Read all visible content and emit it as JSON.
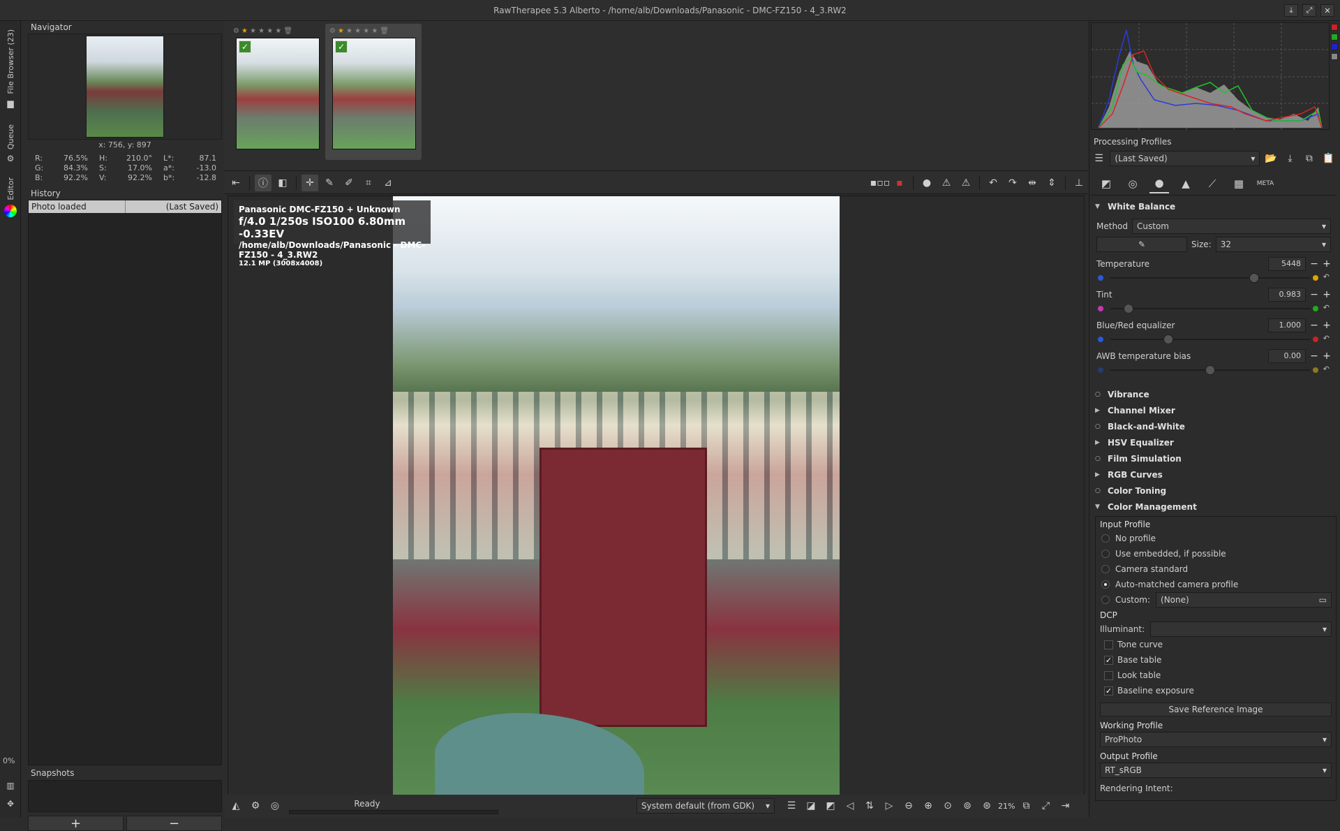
{
  "window": {
    "title": "RawTherapee 5.3 Alberto - /home/alb/Downloads/Panasonic - DMC-FZ150 - 4_3.RW2",
    "btn_min": "⤓",
    "btn_max": "⤢",
    "btn_close": "✕"
  },
  "vtabs": {
    "file_browser": "File Browser (23)",
    "queue": "Queue",
    "editor": "Editor",
    "pct": "0%"
  },
  "navigator": {
    "title": "Navigator",
    "coords": "x: 756, y: 897",
    "rows": [
      {
        "a": "R:",
        "av": "76.5%",
        "b": "H:",
        "bv": "210.0°",
        "c": "L*:",
        "cv": "87.1"
      },
      {
        "a": "G:",
        "av": "84.3%",
        "b": "S:",
        "bv": "17.0%",
        "c": "a*:",
        "cv": "-13.0"
      },
      {
        "a": "B:",
        "av": "92.2%",
        "b": "V:",
        "bv": "92.2%",
        "c": "b*:",
        "cv": "-12.8"
      }
    ]
  },
  "history": {
    "title": "History",
    "item": "Photo loaded",
    "item_profile": "(Last Saved)"
  },
  "snapshots": {
    "title": "Snapshots",
    "add": "+",
    "remove": "−"
  },
  "filmstrip": {
    "stars1": "★",
    "stars_rest": "★ ★ ★ ★"
  },
  "infobox": {
    "line1": "Panasonic DMC-FZ150 + Unknown",
    "line2": "f/4.0  1/250s  ISO100  6.80mm  -0.33EV",
    "line3": "/home/alb/Downloads/Panasonic - DMC-FZ150 - 4_3.RW2",
    "line4": "12.1 MP (3008x4008)"
  },
  "status": {
    "ready": "Ready",
    "monitor_profile": "System default (from GDK)",
    "zoom": "21%"
  },
  "profiles": {
    "title": "Processing Profiles",
    "value": "(Last Saved)"
  },
  "whitebalance": {
    "title": "White Balance",
    "method_label": "Method",
    "method_value": "Custom",
    "size_label": "Size:",
    "size_value": "32",
    "temp_label": "Temperature",
    "temp_value": "5448",
    "tint_label": "Tint",
    "tint_value": "0.983",
    "bre_label": "Blue/Red equalizer",
    "bre_value": "1.000",
    "awb_label": "AWB temperature bias",
    "awb_value": "0.00"
  },
  "slider_levels": {
    "temperature": 0.72,
    "tint": 0.09,
    "bre": 0.29,
    "awb": 0.5
  },
  "sections": [
    "Vibrance",
    "Channel Mixer",
    "Black-and-White",
    "HSV Equalizer",
    "Film Simulation",
    "RGB Curves",
    "Color Toning"
  ],
  "colormgmt": {
    "title": "Color Management",
    "input_profile": "Input Profile",
    "opts": [
      "No profile",
      "Use embedded, if possible",
      "Camera standard",
      "Auto-matched camera profile"
    ],
    "custom_label": "Custom:",
    "custom_value": "(None)",
    "dcp": "DCP",
    "illuminant": "Illuminant:",
    "checks": [
      "Tone curve",
      "Base table",
      "Look table",
      "Baseline exposure"
    ],
    "save_ref": "Save Reference Image",
    "working_profile": "Working Profile",
    "working_value": "ProPhoto",
    "output_profile": "Output Profile",
    "output_value": "RT_sRGB",
    "rendering_intent": "Rendering Intent:"
  }
}
